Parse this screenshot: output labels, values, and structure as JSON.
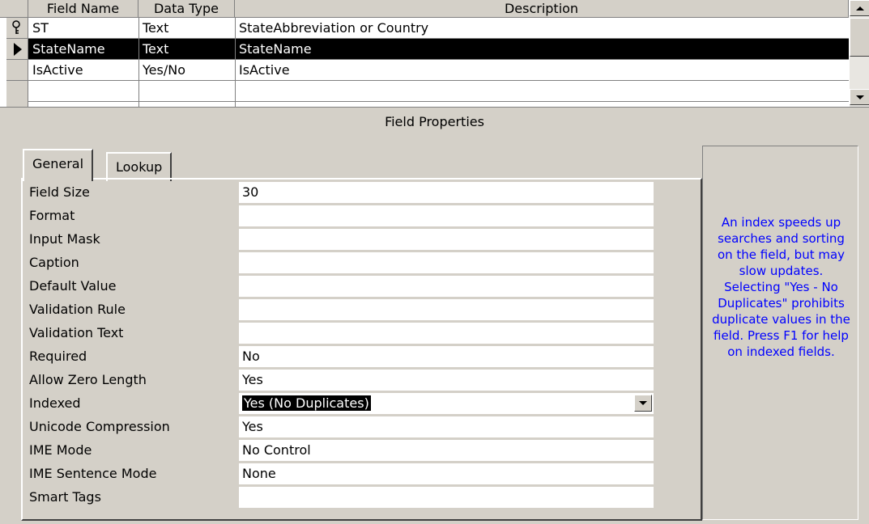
{
  "columns": {
    "field_name": "Field Name",
    "data_type": "Data Type",
    "description": "Description"
  },
  "rows": [
    {
      "field_name": "ST",
      "data_type": "Text",
      "description": "StateAbbreviation or Country",
      "indicator": "primary-key"
    },
    {
      "field_name": "StateName",
      "data_type": "Text",
      "description": "StateName",
      "indicator": "current-row"
    },
    {
      "field_name": "IsActive",
      "data_type": "Yes/No",
      "description": "IsActive",
      "indicator": ""
    }
  ],
  "field_properties_title": "Field Properties",
  "tabs": {
    "general": "General",
    "lookup": "Lookup"
  },
  "properties": [
    {
      "label": "Field Size",
      "value": "30"
    },
    {
      "label": "Format",
      "value": ""
    },
    {
      "label": "Input Mask",
      "value": ""
    },
    {
      "label": "Caption",
      "value": ""
    },
    {
      "label": "Default Value",
      "value": ""
    },
    {
      "label": "Validation Rule",
      "value": ""
    },
    {
      "label": "Validation Text",
      "value": ""
    },
    {
      "label": "Required",
      "value": "No"
    },
    {
      "label": "Allow Zero Length",
      "value": "Yes"
    },
    {
      "label": "Indexed",
      "value": "Yes (No Duplicates)"
    },
    {
      "label": "Unicode Compression",
      "value": "Yes"
    },
    {
      "label": "IME Mode",
      "value": "No Control"
    },
    {
      "label": "IME Sentence Mode",
      "value": "None"
    },
    {
      "label": "Smart Tags",
      "value": ""
    }
  ],
  "help_text": "An index speeds up searches and sorting on the field, but may slow updates. Selecting \"Yes - No Duplicates\" prohibits duplicate values in the field.  Press F1 for help on indexed fields.",
  "colors": {
    "window_bg": "#d4d0c8",
    "help_text": "#0000ff",
    "selection": "#000000"
  },
  "icons": {
    "key": "primary-key-icon",
    "current_row": "current-row-arrow-icon",
    "scroll_up": "scroll-up-arrow-icon",
    "scroll_down": "scroll-down-arrow-icon",
    "dropdown": "dropdown-arrow-icon"
  }
}
